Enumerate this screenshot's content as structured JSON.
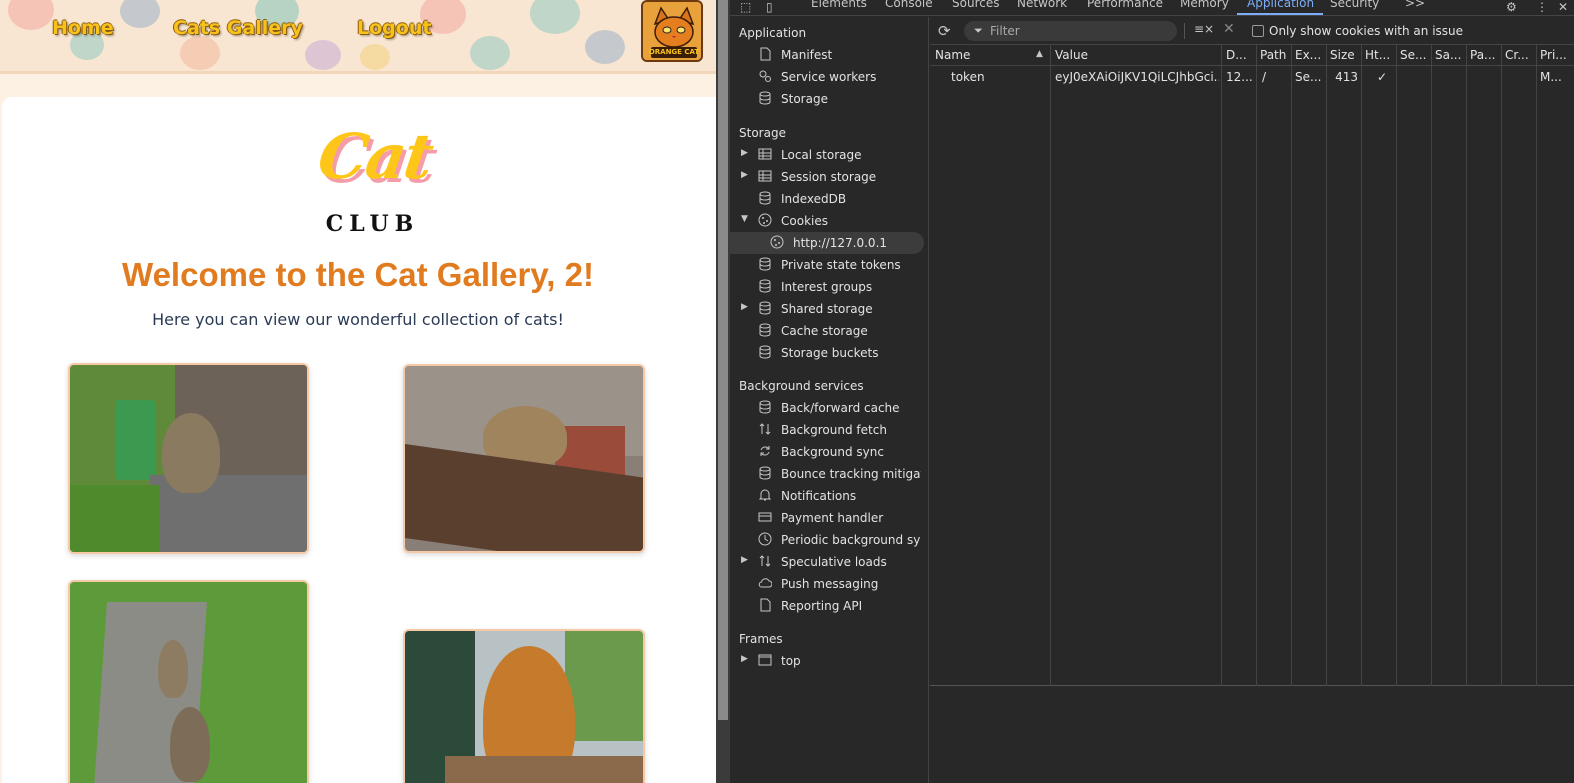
{
  "site": {
    "nav": {
      "home": "Home",
      "gallery": "Cats Gallery",
      "logout": "Logout",
      "logo_badge": "ORANGE CAT"
    },
    "logo": {
      "word": "Cat",
      "sub": "CLUB"
    },
    "welcome": "Welcome to the Cat Gallery, 2!",
    "subtitle": "Here you can view our wonderful collection of cats!",
    "photos": [
      "Tabby cat on step",
      "Tabby cat on wooden plank",
      "Two tabby cats on path",
      "Ginger cat by window"
    ],
    "colors": {
      "accent": "#e07b1f",
      "nav_text": "#f7c21b",
      "logo_yellow": "#ffc61a",
      "logo_pink": "#f59cab"
    }
  },
  "devtools": {
    "tabs": [
      "Elements",
      "Console",
      "Sources",
      "Network",
      "Performance",
      "Memory",
      "Application",
      "Security"
    ],
    "active_tab": "Application",
    "more_tabs": ">>",
    "sidebar": {
      "section_application": "Application",
      "application_items": [
        "Manifest",
        "Service workers",
        "Storage"
      ],
      "section_storage": "Storage",
      "storage_items": [
        "Local storage",
        "Session storage",
        "IndexedDB",
        "Cookies",
        "Private state tokens",
        "Interest groups",
        "Shared storage",
        "Cache storage",
        "Storage buckets"
      ],
      "cookie_origin": "http://127.0.0.1",
      "section_background": "Background services",
      "background_items": [
        "Back/forward cache",
        "Background fetch",
        "Background sync",
        "Bounce tracking mitigat...",
        "Notifications",
        "Payment handler",
        "Periodic background sync",
        "Speculative loads",
        "Push messaging",
        "Reporting API"
      ],
      "section_frames": "Frames",
      "frames_items": [
        "top"
      ]
    },
    "toolbar": {
      "filter_placeholder": "Filter",
      "issue_checkbox_label": "Only show cookies with an issue"
    },
    "columns": [
      "Name",
      "Value",
      "D...",
      "Path",
      "Ex...",
      "Size",
      "Ht...",
      "Se...",
      "Sa...",
      "Pa...",
      "Cr...",
      "Pri..."
    ],
    "cookies": [
      {
        "name": "token",
        "value": "eyJ0eXAiOiJKV1QiLCJhbGci...",
        "domain": "12...",
        "path": "/",
        "expires": "Se...",
        "size": "413",
        "httponly": "✓",
        "secure": "",
        "samesite": "",
        "partition": "",
        "cross_site": "",
        "priority": "M..."
      }
    ]
  }
}
